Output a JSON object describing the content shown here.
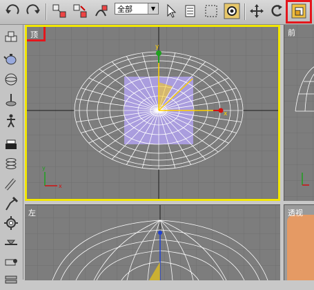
{
  "toolbar": {
    "selection_filter": "全部",
    "buttons": [
      "undo-icon",
      "redo-icon",
      "link-icon",
      "unlink-icon",
      "bind-space-warp-icon",
      "select-object-icon",
      "select-by-name-icon",
      "rectangle-selection-icon",
      "window-crossing-icon",
      "select-move-icon",
      "select-rotate-icon",
      "select-scale-icon"
    ]
  },
  "viewports": {
    "top": {
      "label": "顶",
      "axis_x": "x",
      "axis_y": "y"
    },
    "front": {
      "label": "前"
    },
    "left": {
      "label": "左"
    },
    "perspective": {
      "label": "透视"
    }
  },
  "colors": {
    "highlight": "#e4161c",
    "active_border": "#f2e600",
    "viewport_bg": "#7d7d7d",
    "wireframe": "#ffffff",
    "selection_fill": "#b9a8ff",
    "gizmo_yellow": "#ffd200"
  }
}
